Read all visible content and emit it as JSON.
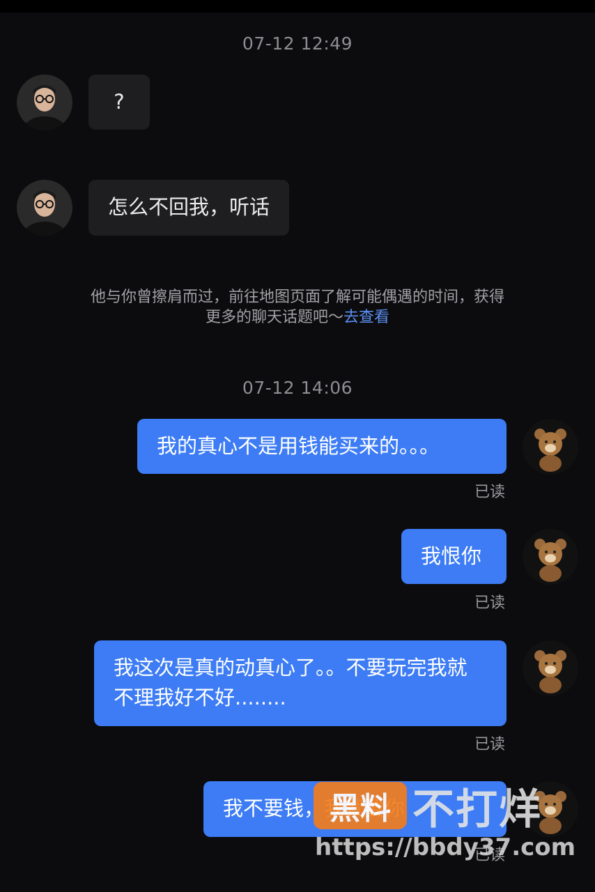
{
  "timestamps": [
    "07-12 12:49",
    "07-12 14:06"
  ],
  "incoming": [
    {
      "text": "?"
    },
    {
      "text": "怎么不回我，听话"
    }
  ],
  "hint": {
    "line1": "他与你曾擦肩而过，前往地图页面了解可能偶遇的时间，获得",
    "line2": "更多的聊天话题吧～",
    "link": "去查看"
  },
  "outgoing": [
    {
      "text": "我的真心不是用钱能买来的。。。",
      "status": "已读"
    },
    {
      "text": "我恨你",
      "status": "已读"
    },
    {
      "text": "我这次是真的动真心了。。不要玩完我就不理我好不好........",
      "status": "已读"
    },
    {
      "text": "我不要钱，我就要你",
      "status": "已读"
    }
  ],
  "watermark": {
    "badge": "黑料",
    "text": "不打烊",
    "url": "https://bbdy37.com"
  },
  "colors": {
    "background": "#0c0c0e",
    "outgoing_bubble": "#3d7cf4",
    "incoming_bubble": "#1e1e20",
    "link": "#5b8ff2",
    "watermark_badge": "#f07d1e"
  },
  "icons": [
    "user-avatar",
    "bear-avatar"
  ]
}
